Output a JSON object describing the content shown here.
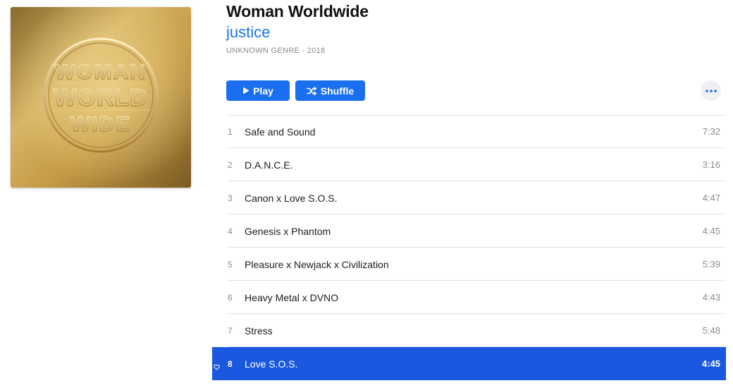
{
  "album": {
    "title": "Woman Worldwide",
    "artist": "justice",
    "meta": "UNKNOWN GENRE · 2018",
    "artwork_lettering": "WOMAN WORLD WIDE"
  },
  "actions": {
    "play_label": "Play",
    "shuffle_label": "Shuffle",
    "more_icon": "ellipsis-icon"
  },
  "colors": {
    "accent": "#1a6ff0",
    "selection": "#1a58e0",
    "artwork_gold": "#c9a04a"
  },
  "tracks": [
    {
      "number": "1",
      "name": "Safe and Sound",
      "duration": "7:32"
    },
    {
      "number": "2",
      "name": "D.A.N.C.E.",
      "duration": "3:16"
    },
    {
      "number": "3",
      "name": "Canon x Love S.O.S.",
      "duration": "4:47"
    },
    {
      "number": "4",
      "name": "Genesis x Phantom",
      "duration": "4:45"
    },
    {
      "number": "5",
      "name": "Pleasure x Newjack x Civilization",
      "duration": "5:39"
    },
    {
      "number": "6",
      "name": "Heavy Metal x DVNO",
      "duration": "4:43"
    },
    {
      "number": "7",
      "name": "Stress",
      "duration": "5:48"
    },
    {
      "number": "8",
      "name": "Love S.O.S.",
      "duration": "4:45",
      "selected": true,
      "loved": true
    }
  ]
}
